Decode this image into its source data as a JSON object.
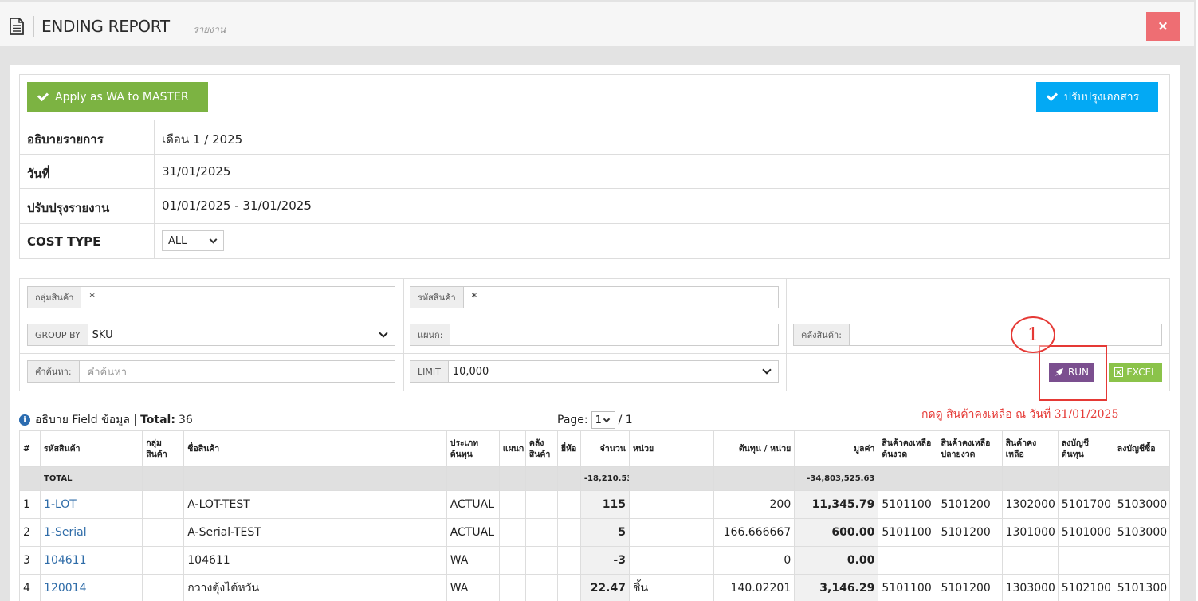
{
  "header": {
    "title": "ENDING REPORT",
    "subtitle": "รายงาน",
    "close_label": "×"
  },
  "actions": {
    "apply_label": "Apply as WA to MASTER",
    "update_label": "ปรับปรุงเอกสาร"
  },
  "info": {
    "description_label": "อธิบายรายการ",
    "description_value": "เดือน 1 / 2025",
    "date_label": "วันที่",
    "date_value": "31/01/2025",
    "adjust_label": "ปรับปรุงรายงาน",
    "adjust_value": "01/01/2025 - 31/01/2025",
    "cost_type_label": "COST TYPE",
    "cost_type_value": "ALL"
  },
  "filters": {
    "group_label": "กลุ่มสินค้า",
    "group_value": "*",
    "sku_label": "รหัสสินค้า",
    "sku_value": "*",
    "group_by_label": "GROUP BY",
    "group_by_value": "SKU",
    "dept_label": "แผนก:",
    "dept_value": "",
    "warehouse_label": "คลังสินค้า:",
    "warehouse_value": "",
    "search_label": "คำค้นหา:",
    "search_placeholder": "คำค้นหา",
    "limit_label": "LIMIT",
    "limit_value": "10,000",
    "run_label": "RUN",
    "excel_label": "EXCEL"
  },
  "annotation": {
    "number": "1",
    "note": "กดดู สินค้าคงเหลือ ณ วันที่ 31/01/2025"
  },
  "summary": {
    "text": "อธิบาย Field ข้อมูล | ",
    "total_label": "Total:",
    "total_value": "36"
  },
  "pager": {
    "label": "Page:",
    "current": "1",
    "of": "/ 1"
  },
  "table": {
    "headers": [
      "#",
      "รหัสสินค้า",
      "กลุ่ม สินค้า",
      "ชื่อสินค้า",
      "ประเภท ต้นทุน",
      "แผนก",
      "คลัง สินค้า",
      "ยี่ห้อ",
      "จำนวน",
      "หน่วย",
      "ต้นทุน / หน่วย",
      "มูลค่า",
      "สินค้าคงเหลือ ต้นงวด",
      "สินค้าคงเหลือ ปลายงวด",
      "สินค้าคงเหลือ",
      "ลงบัญชี ต้นทุน",
      "ลงบัญชีซื้อ"
    ],
    "total": {
      "label": "TOTAL",
      "qty": "-18,210.53",
      "value": "-34,803,525.63"
    },
    "rows": [
      {
        "no": "1",
        "sku": "1-LOT",
        "group": "",
        "name": "A-LOT-TEST",
        "cost_type": "ACTUAL",
        "dept": "",
        "wh": "",
        "brand": "",
        "qty": "115",
        "unit": "",
        "unit_cost": "200",
        "value": "11,345.79",
        "c1": "5101100",
        "c2": "5101200",
        "c3": "1302000",
        "c4": "5101700",
        "c5": "5103000"
      },
      {
        "no": "2",
        "sku": "1-Serial",
        "group": "",
        "name": "A-Serial-TEST",
        "cost_type": "ACTUAL",
        "dept": "",
        "wh": "",
        "brand": "",
        "qty": "5",
        "unit": "",
        "unit_cost": "166.666667",
        "value": "600.00",
        "c1": "5101100",
        "c2": "5101200",
        "c3": "1301000",
        "c4": "5101000",
        "c5": "5103000"
      },
      {
        "no": "3",
        "sku": "104611",
        "group": "",
        "name": "104611",
        "cost_type": "WA",
        "dept": "",
        "wh": "",
        "brand": "",
        "qty": "-3",
        "unit": "",
        "unit_cost": "0",
        "value": "0.00",
        "c1": "",
        "c2": "",
        "c3": "",
        "c4": "",
        "c5": ""
      },
      {
        "no": "4",
        "sku": "120014",
        "group": "",
        "name": "กวางตุ้งไต้หวัน",
        "cost_type": "WA",
        "dept": "",
        "wh": "",
        "brand": "",
        "qty": "22.47",
        "unit": "ชิ้น",
        "unit_cost": "140.02201",
        "value": "3,146.29",
        "c1": "5101100",
        "c2": "5101200",
        "c3": "1303000",
        "c4": "5102100",
        "c5": "5101300"
      }
    ]
  }
}
